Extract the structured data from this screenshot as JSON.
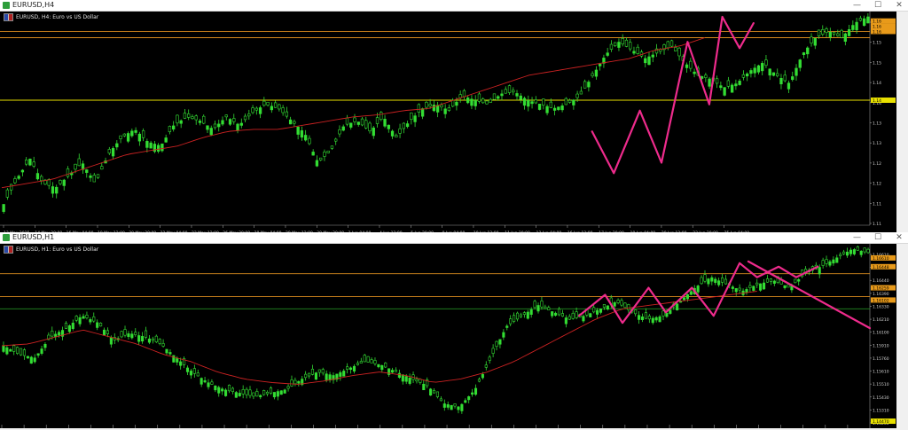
{
  "colors": {
    "candle": "#33dd33",
    "ma": "#cc2222",
    "trend": "#ee2b8c",
    "level_yellow": "#e8e000",
    "level_orange": "#d88a1e",
    "level_green": "#228b22",
    "price_tag_orange": "#e89a1a"
  },
  "icons": {
    "window": "chart-window-icon",
    "minimize": "minimize-icon",
    "maximize": "maximize-icon",
    "close": "close-icon",
    "flag": "currency-flag-icon"
  },
  "windows": {
    "h4": {
      "title": "EURUSD,H4",
      "label": "EURUSD, H4:  Euro vs US Dollar",
      "minimize": "—",
      "maximize": "☐",
      "close": "✕"
    },
    "h1": {
      "title": "EURUSD,H1",
      "label": "EURUSD, H1:  Euro vs US Dollar",
      "minimize": "—",
      "maximize": "☐",
      "close": "✕"
    }
  },
  "chart_data": [
    {
      "type": "candlestick",
      "symbol": "EURUSD",
      "timeframe": "H4",
      "x_ticks": [
        "13 May 2025",
        "14 May 20:00",
        "16 May 04:00",
        "19 May 12:00",
        "20 May 20:00",
        "22 May 04:00",
        "23 May 12:00",
        "26 May 20:00",
        "28 May 04:00",
        "29 May 12:00",
        "30 May 20:00",
        "3 Jun 04:00",
        "4 Jun 12:00",
        "5 Jun 20:00",
        "9 Jun 04:00",
        "10 Jun 12:00",
        "11 Jun 20:00",
        "13 Jun 04:00",
        "16 Jun 12:00",
        "17 Jun 20:00",
        "19 Jun 04:00",
        "20 Jun 12:00",
        "23 Jun 20:00",
        "25 Jun 04:00"
      ],
      "y_ticks": [
        "1.16",
        "1.15",
        "1.15",
        "1.14",
        "1.14",
        "1.13",
        "1.13",
        "1.12",
        "1.12",
        "1.11",
        "1.11"
      ],
      "price_tags": [
        "1.16",
        "1.16",
        "1.16",
        "1.14"
      ],
      "close_path": [
        0.1,
        0.22,
        0.32,
        0.2,
        0.18,
        0.24,
        0.3,
        0.2,
        0.34,
        0.42,
        0.46,
        0.4,
        0.38,
        0.48,
        0.52,
        0.5,
        0.46,
        0.52,
        0.48,
        0.54,
        0.58,
        0.56,
        0.5,
        0.44,
        0.3,
        0.36,
        0.48,
        0.5,
        0.45,
        0.52,
        0.42,
        0.5,
        0.56,
        0.58,
        0.55,
        0.62,
        0.6,
        0.58,
        0.63,
        0.64,
        0.6,
        0.58,
        0.56,
        0.58,
        0.62,
        0.72,
        0.82,
        0.88,
        0.84,
        0.8,
        0.83,
        0.86,
        0.78,
        0.72,
        0.7,
        0.66,
        0.68,
        0.74,
        0.78,
        0.72,
        0.68,
        0.82,
        0.9,
        0.93,
        0.9,
        0.97,
        1.0
      ],
      "ma_path": [
        0.18,
        0.2,
        0.22,
        0.26,
        0.3,
        0.34,
        0.36,
        0.38,
        0.42,
        0.45,
        0.46,
        0.46,
        0.48,
        0.5,
        0.52,
        0.53,
        0.55,
        0.56,
        0.6,
        0.64,
        0.68,
        0.72,
        0.74,
        0.76,
        0.78,
        0.8,
        0.84,
        0.86,
        0.9
      ],
      "levels": [
        {
          "color": "level_orange",
          "value": 0.93
        },
        {
          "color": "level_orange",
          "value": 0.9
        },
        {
          "color": "level_yellow",
          "value": 0.6
        }
      ],
      "trend_lines": [
        [
          [
            0.68,
            0.45
          ],
          [
            0.705,
            0.25
          ],
          [
            0.735,
            0.55
          ],
          [
            0.76,
            0.3
          ],
          [
            0.79,
            0.88
          ],
          [
            0.815,
            0.58
          ],
          [
            0.83,
            1.0
          ],
          [
            0.85,
            0.85
          ],
          [
            0.866,
            0.97
          ]
        ]
      ]
    },
    {
      "type": "candlestick",
      "symbol": "EURUSD",
      "timeframe": "H1",
      "y_ticks": [
        "1.16610",
        "1.16500",
        "1.16440",
        "1.16390",
        "1.16330",
        "1.16210",
        "1.16100",
        "1.15910",
        "1.15760",
        "1.15610",
        "1.15510",
        "1.15430",
        "1.15310",
        "1.15260"
      ],
      "price_tags": [
        "1.16610",
        "1.16448",
        "1.16259",
        "1.16102",
        "1.14470"
      ],
      "close_path": [
        0.45,
        0.4,
        0.38,
        0.5,
        0.55,
        0.62,
        0.58,
        0.48,
        0.52,
        0.5,
        0.46,
        0.38,
        0.3,
        0.24,
        0.2,
        0.18,
        0.16,
        0.18,
        0.2,
        0.26,
        0.3,
        0.28,
        0.32,
        0.36,
        0.34,
        0.3,
        0.26,
        0.22,
        0.12,
        0.1,
        0.2,
        0.38,
        0.56,
        0.62,
        0.68,
        0.64,
        0.6,
        0.62,
        0.66,
        0.7,
        0.64,
        0.6,
        0.62,
        0.7,
        0.78,
        0.84,
        0.8,
        0.76,
        0.8,
        0.82,
        0.78,
        0.86,
        0.9,
        0.95,
        1.0,
        0.98
      ],
      "ma_path": [
        0.45,
        0.46,
        0.5,
        0.54,
        0.5,
        0.46,
        0.4,
        0.36,
        0.3,
        0.26,
        0.24,
        0.23,
        0.25,
        0.28,
        0.3,
        0.28,
        0.24,
        0.26,
        0.3,
        0.36,
        0.44,
        0.52,
        0.6,
        0.66,
        0.68,
        0.7,
        0.72,
        0.74,
        0.76
      ],
      "levels": [
        {
          "color": "level_orange",
          "value": 0.86
        },
        {
          "color": "level_orange",
          "value": 0.73
        },
        {
          "color": "level_green",
          "value": 0.66
        }
      ],
      "trend_lines": [
        [
          [
            0.665,
            0.62
          ],
          [
            0.695,
            0.74
          ],
          [
            0.715,
            0.58
          ],
          [
            0.745,
            0.78
          ],
          [
            0.765,
            0.64
          ],
          [
            0.795,
            0.78
          ],
          [
            0.82,
            0.62
          ],
          [
            0.85,
            0.92
          ],
          [
            0.87,
            0.84
          ],
          [
            0.895,
            0.9
          ],
          [
            0.915,
            0.84
          ],
          [
            0.94,
            0.9
          ]
        ],
        [
          [
            0.86,
            0.93
          ],
          [
            1.0,
            0.55
          ]
        ]
      ]
    }
  ]
}
